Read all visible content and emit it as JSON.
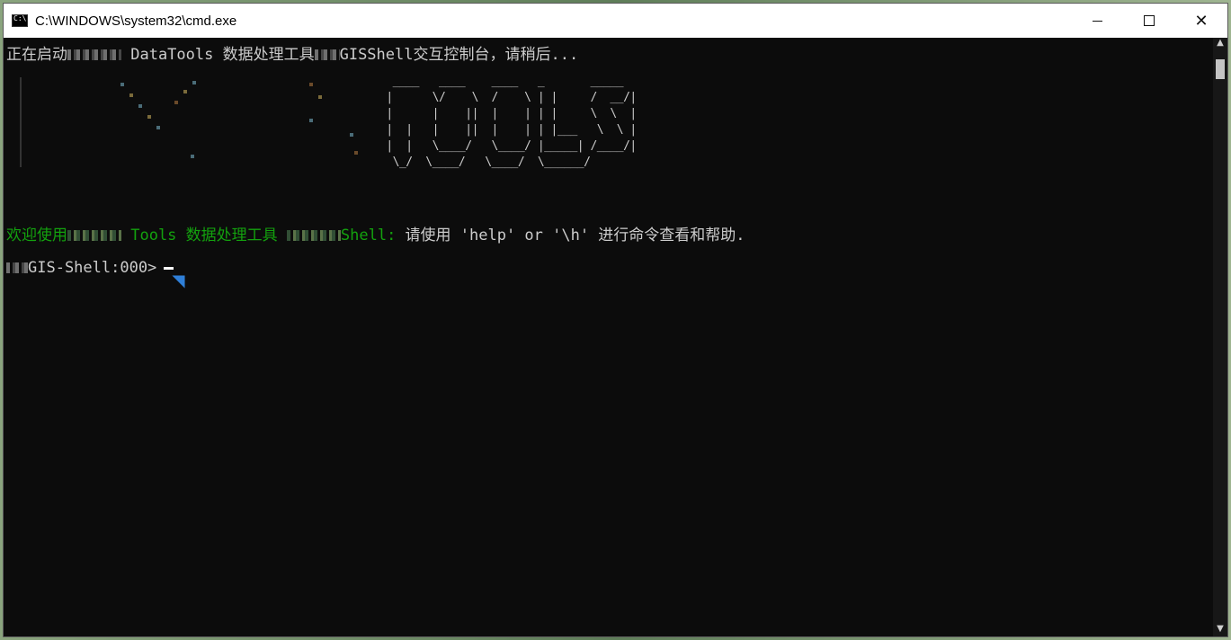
{
  "window": {
    "title": "C:\\WINDOWS\\system32\\cmd.exe",
    "controls": {
      "minimize": "",
      "maximize": "",
      "close": "✕"
    }
  },
  "console": {
    "startup_prefix": "正在启动",
    "startup_tools": " DataTools 数据处理工具",
    "startup_suffix": "GISShell交互控制台，请稍后...",
    "ascii_logo": "  ____   ____    ____   _       _____ \n |      \\/    \\  /    \\ | |     /  __/|\n |      |    ||  |    | | |     \\  \\  |\n |  |   |    ||  |    | | |___   \\  \\ |\n |  |   \\____/   \\____/ |_____| /____/|\n  \\_/  \\____/   \\____/  \\______/      \n",
    "welcome_prefix": "欢迎使用",
    "welcome_tools": " Tools 数据处理工具 ",
    "welcome_shell": "Shell:",
    "welcome_help": " 请使用 'help' or '\\h' 进行命令查看和帮助.",
    "prompt": "GIS-Shell:000>"
  },
  "colors": {
    "console_bg": "#0c0c0c",
    "text": "#cccccc",
    "accent_green": "#13a10e",
    "cursor_blue": "#2f7fd8"
  },
  "icons": {
    "app": "cmd-icon",
    "minimize": "minimize-icon",
    "maximize": "maximize-icon",
    "close": "close-icon",
    "pointer": "mouse-pointer-icon"
  }
}
